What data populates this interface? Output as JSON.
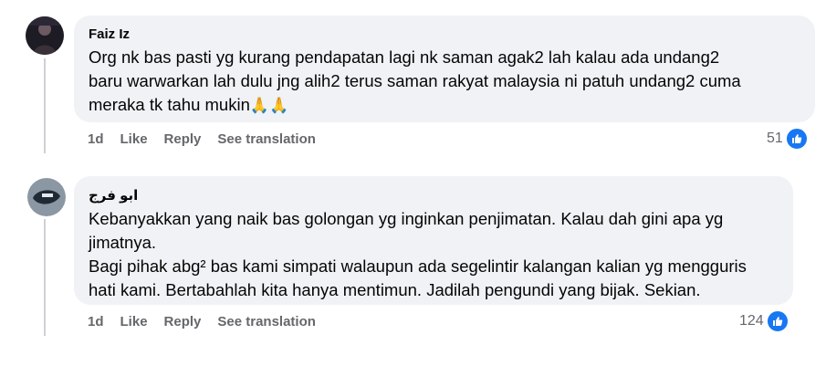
{
  "comments": [
    {
      "author": "Faiz Iz",
      "lines": [
        "Org nk bas pasti yg kurang pendapatan lagi nk saman agak2 lah kalau ada undang2",
        "baru warwarkan lah dulu jng alih2 terus saman rakyat malaysia ni patuh undang2 cuma",
        "meraka tk tahu mukin"
      ],
      "emoji": "🙏🙏",
      "time": "1d",
      "like_label": "Like",
      "reply_label": "Reply",
      "translate_label": "See translation",
      "reaction_count": "51"
    },
    {
      "author": "ابو فرج",
      "lines": [
        "Kebanyakkan yang naik bas golongan yg inginkan penjimatan. Kalau dah gini apa yg",
        "jimatnya.",
        "Bagi pihak abg² bas kami simpati walaupun ada segelintir kalangan kalian yg mengguris",
        "hati kami. Bertabahlah kita hanya mentimun. Jadilah pengundi yang bijak. Sekian."
      ],
      "time": "1d",
      "like_label": "Like",
      "reply_label": "Reply",
      "translate_label": "See translation",
      "reaction_count": "124"
    }
  ],
  "colors": {
    "bubble": "#f0f2f5",
    "meta_text": "#65676b",
    "like_blue": "#1877f2",
    "thread_line": "#ced0d4"
  },
  "icons": {
    "reaction": "like-thumb-icon"
  }
}
